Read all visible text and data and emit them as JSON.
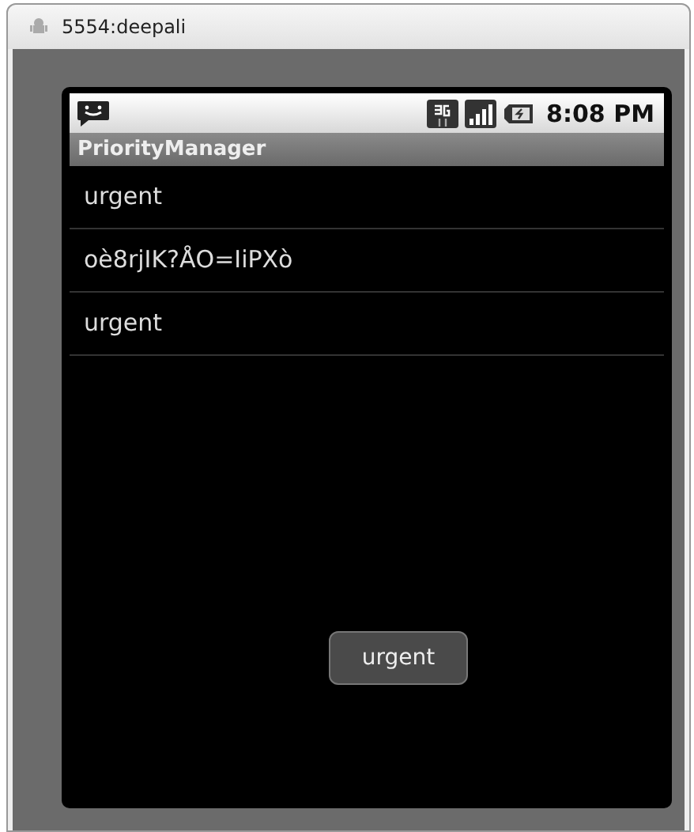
{
  "window": {
    "title": "5554:deepali"
  },
  "status_bar": {
    "time": "8:08 PM"
  },
  "app": {
    "title": "PriorityManager"
  },
  "list": {
    "items": [
      "urgent",
      "oè8rjIK?ÅO=IiPXò",
      "urgent"
    ]
  },
  "toast": {
    "text": "urgent"
  }
}
